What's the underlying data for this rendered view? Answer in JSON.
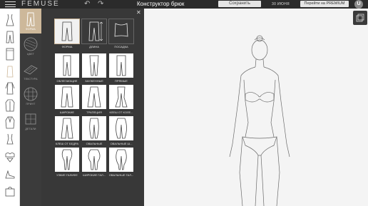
{
  "topbar": {
    "logo": "FEMUSE",
    "undo_icon": "undo-icon",
    "redo_icon": "redo-icon",
    "title": "Конструктор брюк",
    "save_label": "Сохранить",
    "date": "30 ИЮНЯ",
    "premium_label": "Перейти на PREMIUM",
    "user_initial": "U"
  },
  "sidebar": {
    "items": [
      {
        "icon": "dress-icon"
      },
      {
        "icon": "trousers-icon"
      },
      {
        "icon": "skirt-icon"
      },
      {
        "icon": "top-icon"
      },
      {
        "icon": "shirt-icon"
      },
      {
        "icon": "jacket-icon"
      },
      {
        "icon": "coat-icon"
      },
      {
        "icon": "swimsuit-icon"
      },
      {
        "icon": "lingerie-icon"
      },
      {
        "icon": "shoe-icon"
      },
      {
        "icon": "bag-icon"
      }
    ]
  },
  "tools": [
    {
      "label": "ФОРМА",
      "icon": "shape-icon",
      "active": true
    },
    {
      "label": "ЦВЕТ",
      "icon": "color-icon",
      "active": false
    },
    {
      "label": "ТЕКСТУРА",
      "icon": "texture-icon",
      "active": false
    },
    {
      "label": "ПРИНТ",
      "icon": "print-icon",
      "active": false
    },
    {
      "label": "ДЕТАЛИ",
      "icon": "details-icon",
      "active": false
    }
  ],
  "options": [
    {
      "caption": "ФОРМА"
    },
    {
      "caption": "ДЛИНА"
    },
    {
      "caption": "ПОСАДКА"
    },
    {
      "caption": "ОБЛЕГАЮЩИЕ"
    },
    {
      "caption": "ЗАУЖЕННЫЕ"
    },
    {
      "caption": "ПРЯМЫЕ"
    },
    {
      "caption": "ШИРОКИЕ"
    },
    {
      "caption": "ТРАПЕЦИЯ"
    },
    {
      "caption": "КЛЕШ ОТ КОЛЕ..."
    },
    {
      "caption": "КЛЕШ ОТ БЕДРА"
    },
    {
      "caption": "ОВАЛЬНЫЕ"
    },
    {
      "caption": "ОВАЛЬНЫЕ Ш..."
    },
    {
      "caption": "УЗКИЕ ГАЛИФЕ"
    },
    {
      "caption": "ШИРОКИЕ ГАЛ..."
    },
    {
      "caption": "ОВАЛЬНЫЕ ГАЛ..."
    }
  ],
  "accent_color": "#cdb89a"
}
